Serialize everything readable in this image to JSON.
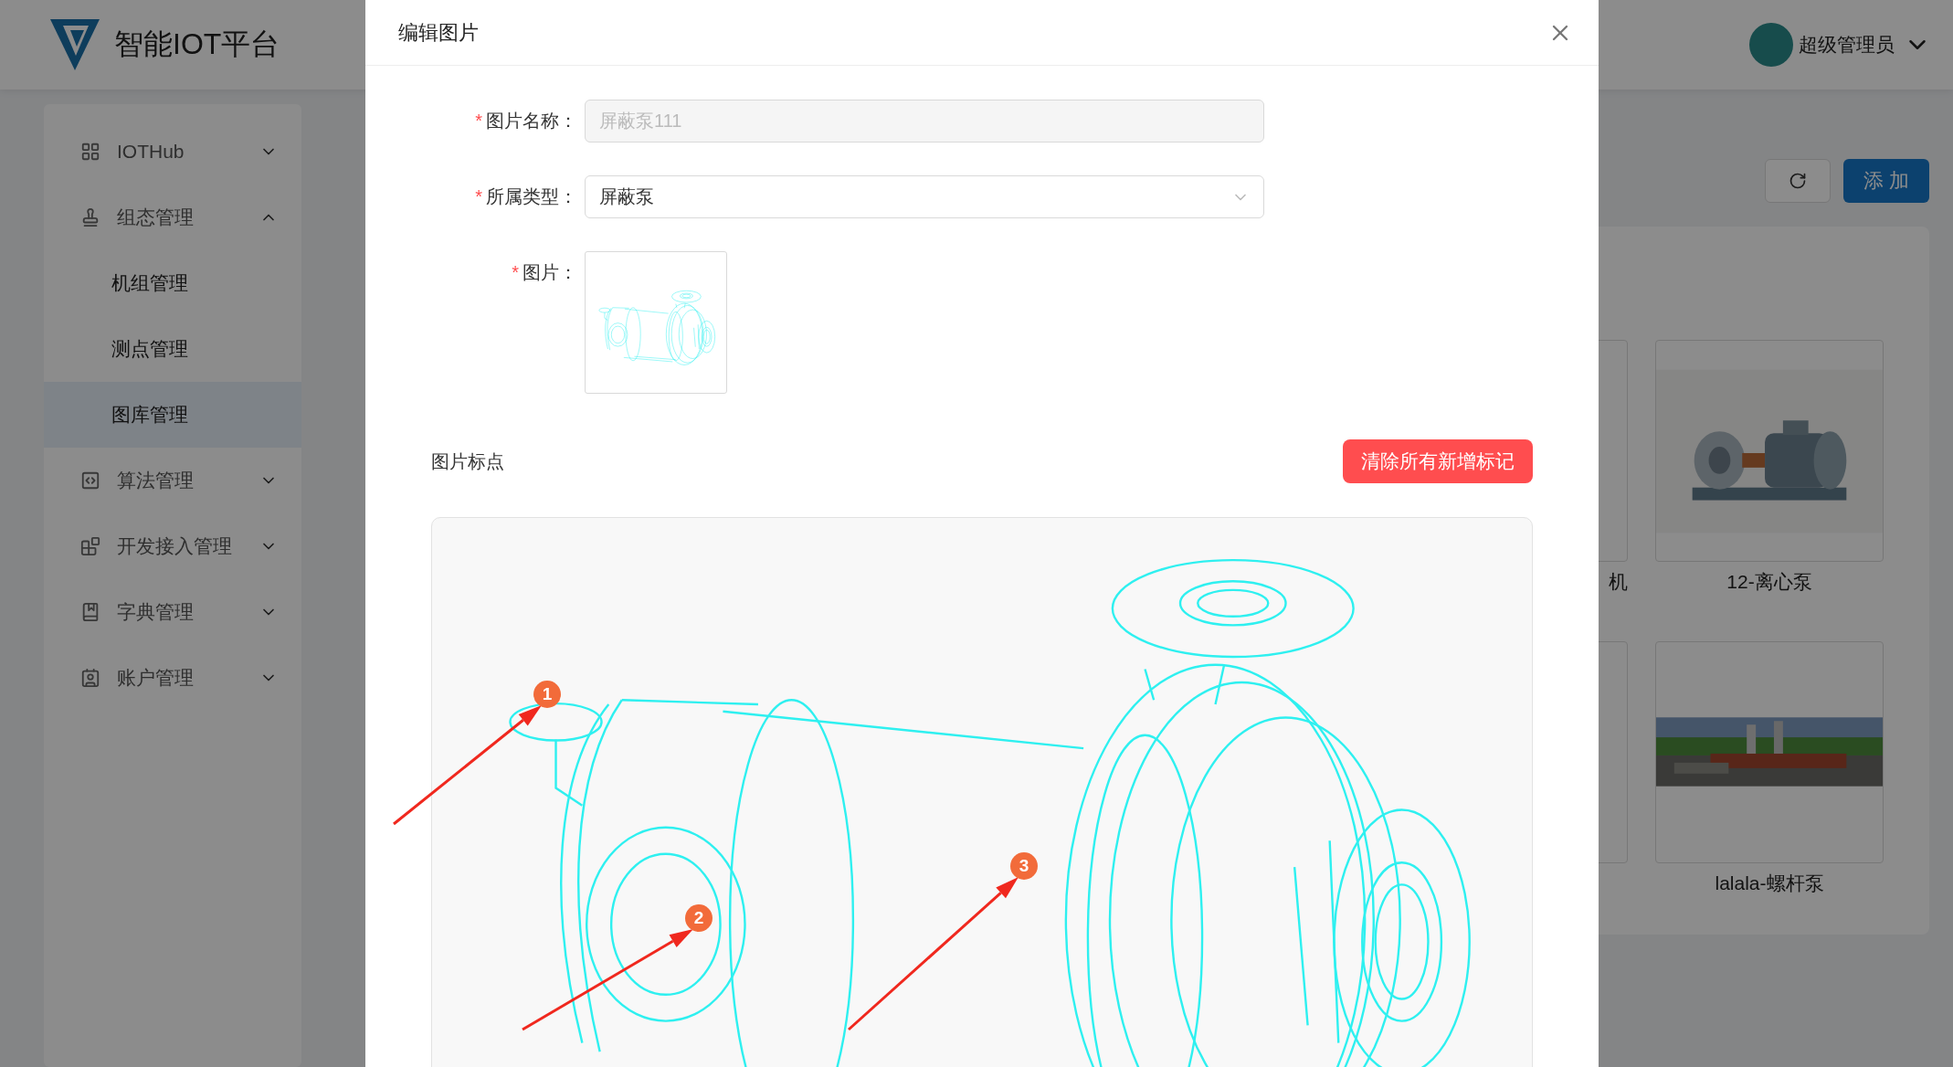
{
  "header": {
    "brand": "智能IOT平台",
    "user": "超级管理员"
  },
  "sidebar": {
    "items": [
      {
        "label": "IOTHub",
        "expanded": false
      },
      {
        "label": "组态管理",
        "expanded": true,
        "children": [
          {
            "label": "机组管理",
            "selected": false
          },
          {
            "label": "测点管理",
            "selected": false
          },
          {
            "label": "图库管理",
            "selected": true
          }
        ]
      },
      {
        "label": "算法管理",
        "expanded": false
      },
      {
        "label": "开发接入管理",
        "expanded": false
      },
      {
        "label": "字典管理",
        "expanded": false
      },
      {
        "label": "账户管理",
        "expanded": false
      }
    ]
  },
  "toolbar": {
    "add_button": "添 加"
  },
  "gallery": {
    "cards": [
      {
        "kind": "partial",
        "label": "机"
      },
      {
        "kind": "picture",
        "label": "12-离心泵"
      },
      {
        "kind": "partial"
      },
      {
        "kind": "picture",
        "label": "lalala-螺杆泵"
      }
    ]
  },
  "modal": {
    "title": "编辑图片",
    "fields": [
      {
        "kind": "text",
        "required_mark": "*",
        "label": "图片名称：",
        "value": "屏蔽泵111",
        "disabled": true
      },
      {
        "kind": "select",
        "required_mark": "*",
        "label": "所属类型：",
        "value": "屏蔽泵"
      },
      {
        "required_mark": "*",
        "label": "图片："
      }
    ],
    "marking": {
      "title": "图片标点",
      "clear_button": "清除所有新增标记",
      "markers": [
        {
          "label": "1"
        },
        {
          "label": "2"
        },
        {
          "label": "3"
        }
      ]
    }
  }
}
